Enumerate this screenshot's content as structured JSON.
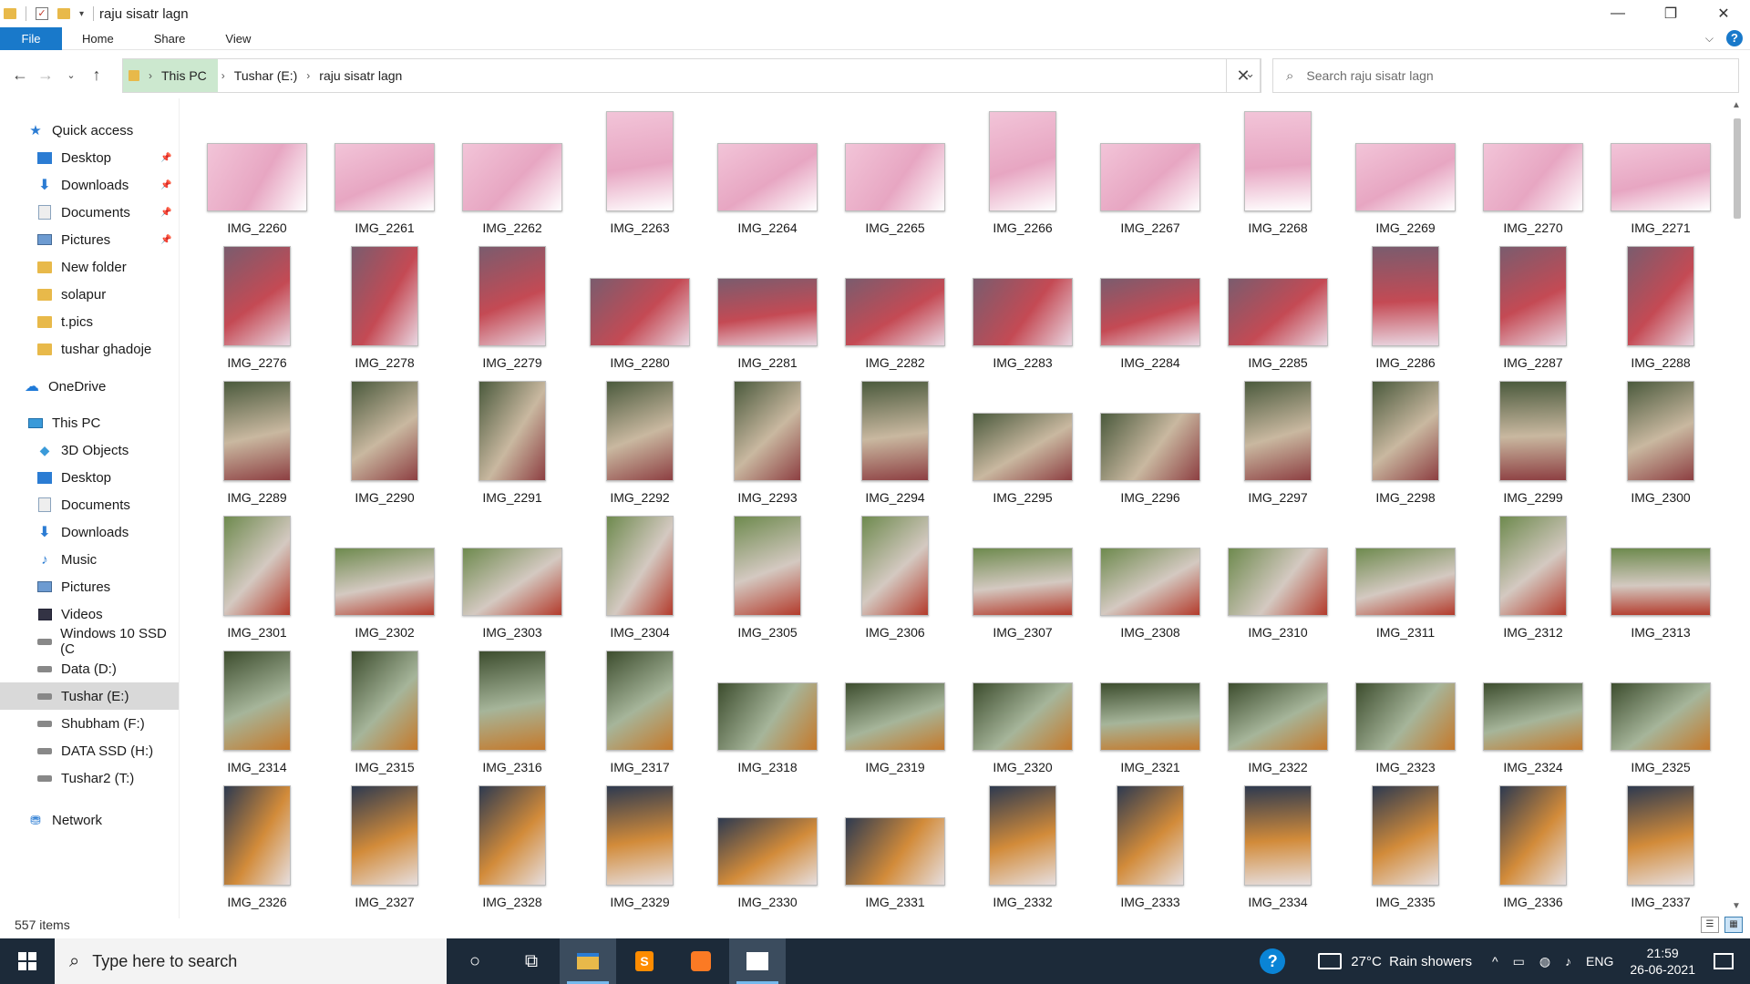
{
  "window": {
    "title": "raju sisatr lagn",
    "controls": [
      "minimize-icon",
      "restore-icon",
      "close-icon"
    ]
  },
  "ribbon": {
    "tabs": [
      "File",
      "Home",
      "Share",
      "View"
    ],
    "help": "?"
  },
  "address": {
    "crumbs": [
      "This PC",
      "Tushar (E:)",
      "raju sisatr lagn"
    ]
  },
  "search": {
    "placeholder": "Search raju sisatr lagn"
  },
  "sidebar": {
    "items": [
      {
        "label": "Quick access",
        "icon": "star-icon"
      },
      {
        "label": "Desktop",
        "icon": "desktop-icon",
        "pinned": true
      },
      {
        "label": "Downloads",
        "icon": "downloads-icon",
        "pinned": true
      },
      {
        "label": "Documents",
        "icon": "documents-icon",
        "pinned": true
      },
      {
        "label": "Pictures",
        "icon": "pictures-icon",
        "pinned": true
      },
      {
        "label": "New folder",
        "icon": "folder-icon"
      },
      {
        "label": "solapur",
        "icon": "folder-icon"
      },
      {
        "label": "t.pics",
        "icon": "folder-icon"
      },
      {
        "label": "tushar ghadoje",
        "icon": "folder-icon"
      },
      {
        "label": "OneDrive",
        "icon": "cloud-icon"
      },
      {
        "label": "This PC",
        "icon": "pc-icon"
      },
      {
        "label": "3D Objects",
        "icon": "3d-objects-icon"
      },
      {
        "label": "Desktop",
        "icon": "desktop-icon"
      },
      {
        "label": "Documents",
        "icon": "documents-icon"
      },
      {
        "label": "Downloads",
        "icon": "downloads-icon"
      },
      {
        "label": "Music",
        "icon": "music-icon"
      },
      {
        "label": "Pictures",
        "icon": "pictures-icon"
      },
      {
        "label": "Videos",
        "icon": "videos-icon"
      },
      {
        "label": "Windows 10 SSD (C",
        "icon": "drive-icon"
      },
      {
        "label": "Data (D:)",
        "icon": "drive-icon"
      },
      {
        "label": "Tushar (E:)",
        "icon": "drive-icon",
        "selected": true
      },
      {
        "label": "Shubham (F:)",
        "icon": "drive-icon"
      },
      {
        "label": "DATA SSD (H:)",
        "icon": "drive-icon"
      },
      {
        "label": "Tushar2 (T:)",
        "icon": "drive-icon"
      },
      {
        "label": "Network",
        "icon": "network-icon"
      }
    ]
  },
  "files": [
    {
      "name": "IMG_2260",
      "orient": "land"
    },
    {
      "name": "IMG_2261",
      "orient": "land"
    },
    {
      "name": "IMG_2262",
      "orient": "land"
    },
    {
      "name": "IMG_2263",
      "orient": "port"
    },
    {
      "name": "IMG_2264",
      "orient": "land"
    },
    {
      "name": "IMG_2265",
      "orient": "land"
    },
    {
      "name": "IMG_2266",
      "orient": "port"
    },
    {
      "name": "IMG_2267",
      "orient": "land"
    },
    {
      "name": "IMG_2268",
      "orient": "port"
    },
    {
      "name": "IMG_2269",
      "orient": "land"
    },
    {
      "name": "IMG_2270",
      "orient": "land"
    },
    {
      "name": "IMG_2271",
      "orient": "land"
    },
    {
      "name": "IMG_2276",
      "orient": "port"
    },
    {
      "name": "IMG_2278",
      "orient": "port"
    },
    {
      "name": "IMG_2279",
      "orient": "port"
    },
    {
      "name": "IMG_2280",
      "orient": "land"
    },
    {
      "name": "IMG_2281",
      "orient": "land"
    },
    {
      "name": "IMG_2282",
      "orient": "land"
    },
    {
      "name": "IMG_2283",
      "orient": "land"
    },
    {
      "name": "IMG_2284",
      "orient": "land"
    },
    {
      "name": "IMG_2285",
      "orient": "land"
    },
    {
      "name": "IMG_2286",
      "orient": "port"
    },
    {
      "name": "IMG_2287",
      "orient": "port"
    },
    {
      "name": "IMG_2288",
      "orient": "port"
    },
    {
      "name": "IMG_2289",
      "orient": "port"
    },
    {
      "name": "IMG_2290",
      "orient": "port"
    },
    {
      "name": "IMG_2291",
      "orient": "port"
    },
    {
      "name": "IMG_2292",
      "orient": "port"
    },
    {
      "name": "IMG_2293",
      "orient": "port"
    },
    {
      "name": "IMG_2294",
      "orient": "port"
    },
    {
      "name": "IMG_2295",
      "orient": "land"
    },
    {
      "name": "IMG_2296",
      "orient": "land"
    },
    {
      "name": "IMG_2297",
      "orient": "port"
    },
    {
      "name": "IMG_2298",
      "orient": "port"
    },
    {
      "name": "IMG_2299",
      "orient": "port"
    },
    {
      "name": "IMG_2300",
      "orient": "port"
    },
    {
      "name": "IMG_2301",
      "orient": "port"
    },
    {
      "name": "IMG_2302",
      "orient": "land"
    },
    {
      "name": "IMG_2303",
      "orient": "land"
    },
    {
      "name": "IMG_2304",
      "orient": "port"
    },
    {
      "name": "IMG_2305",
      "orient": "port"
    },
    {
      "name": "IMG_2306",
      "orient": "port"
    },
    {
      "name": "IMG_2307",
      "orient": "land"
    },
    {
      "name": "IMG_2308",
      "orient": "land"
    },
    {
      "name": "IMG_2310",
      "orient": "land"
    },
    {
      "name": "IMG_2311",
      "orient": "land"
    },
    {
      "name": "IMG_2312",
      "orient": "port"
    },
    {
      "name": "IMG_2313",
      "orient": "land"
    },
    {
      "name": "IMG_2314",
      "orient": "port"
    },
    {
      "name": "IMG_2315",
      "orient": "port"
    },
    {
      "name": "IMG_2316",
      "orient": "port"
    },
    {
      "name": "IMG_2317",
      "orient": "port"
    },
    {
      "name": "IMG_2318",
      "orient": "land"
    },
    {
      "name": "IMG_2319",
      "orient": "land"
    },
    {
      "name": "IMG_2320",
      "orient": "land"
    },
    {
      "name": "IMG_2321",
      "orient": "land"
    },
    {
      "name": "IMG_2322",
      "orient": "land"
    },
    {
      "name": "IMG_2323",
      "orient": "land"
    },
    {
      "name": "IMG_2324",
      "orient": "land"
    },
    {
      "name": "IMG_2325",
      "orient": "land"
    },
    {
      "name": "IMG_2326",
      "orient": "port"
    },
    {
      "name": "IMG_2327",
      "orient": "port"
    },
    {
      "name": "IMG_2328",
      "orient": "port"
    },
    {
      "name": "IMG_2329",
      "orient": "port"
    },
    {
      "name": "IMG_2330",
      "orient": "land"
    },
    {
      "name": "IMG_2331",
      "orient": "land"
    },
    {
      "name": "IMG_2332",
      "orient": "port"
    },
    {
      "name": "IMG_2333",
      "orient": "port"
    },
    {
      "name": "IMG_2334",
      "orient": "port"
    },
    {
      "name": "IMG_2335",
      "orient": "port"
    },
    {
      "name": "IMG_2336",
      "orient": "port"
    },
    {
      "name": "IMG_2337",
      "orient": "port"
    }
  ],
  "status": {
    "item_count": "557 items"
  },
  "taskbar": {
    "search_placeholder": "Type here to search",
    "apps": [
      "cortana-icon",
      "task-view-icon",
      "file-explorer-icon",
      "sublime-text-icon",
      "xampp-icon",
      "photos-icon"
    ],
    "weather": "27°C  Rain showers",
    "language": "ENG",
    "time": "21:59",
    "date": "26-06-2021"
  },
  "colors": {
    "accent": "#1979ca",
    "address_highlight": "#cce8cf",
    "taskbar": "#1c2a39",
    "selection": "#d9d9d9"
  }
}
